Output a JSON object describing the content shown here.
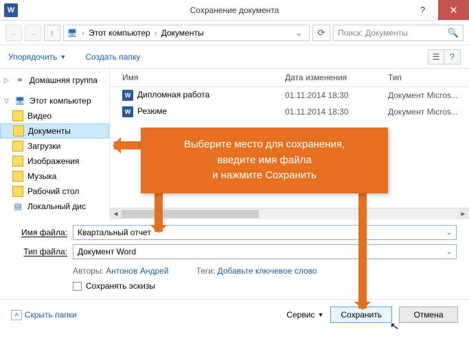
{
  "titlebar": {
    "title": "Сохранение документа"
  },
  "breadcrumb": {
    "seg1": "Этот компьютер",
    "seg2": "Документы"
  },
  "search": {
    "placeholder": "Поиск: Документы"
  },
  "toolbar": {
    "organize": "Упорядочить",
    "newfolder": "Создать папку"
  },
  "sidebar": {
    "homegroup": "Домашняя группа",
    "thispc": "Этот компьютер",
    "items": [
      "Видео",
      "Документы",
      "Загрузки",
      "Изображения",
      "Музыка",
      "Рабочий стол",
      "Локальный дис"
    ]
  },
  "columns": {
    "name": "Имя",
    "modified": "Дата изменения",
    "type": "Тип"
  },
  "files": [
    {
      "name": "Дипломная работа",
      "date": "01.11.2014 18:30",
      "type": "Документ Micros..."
    },
    {
      "name": "Резюме",
      "date": "01.11.2014 18:30",
      "type": "Документ Micros..."
    }
  ],
  "form": {
    "filename_label": "Имя файла:",
    "filename_value": "Квартальный отчет",
    "filetype_label": "Тип файла:",
    "filetype_value": "Документ Word",
    "authors_label": "Авторы:",
    "authors_value": "Антонов Андрей",
    "tags_label": "Теги:",
    "tags_value": "Добавьте ключевое слово",
    "thumb_label": "Сохранять эскизы"
  },
  "footer": {
    "hidefolders": "Скрыть папки",
    "tools": "Сервис",
    "save": "Сохранить",
    "cancel": "Отмена"
  },
  "callout": {
    "line1": "Выберите место для сохранения,",
    "line2": "введите имя файла",
    "line3": "и нажмите Сохранить"
  }
}
